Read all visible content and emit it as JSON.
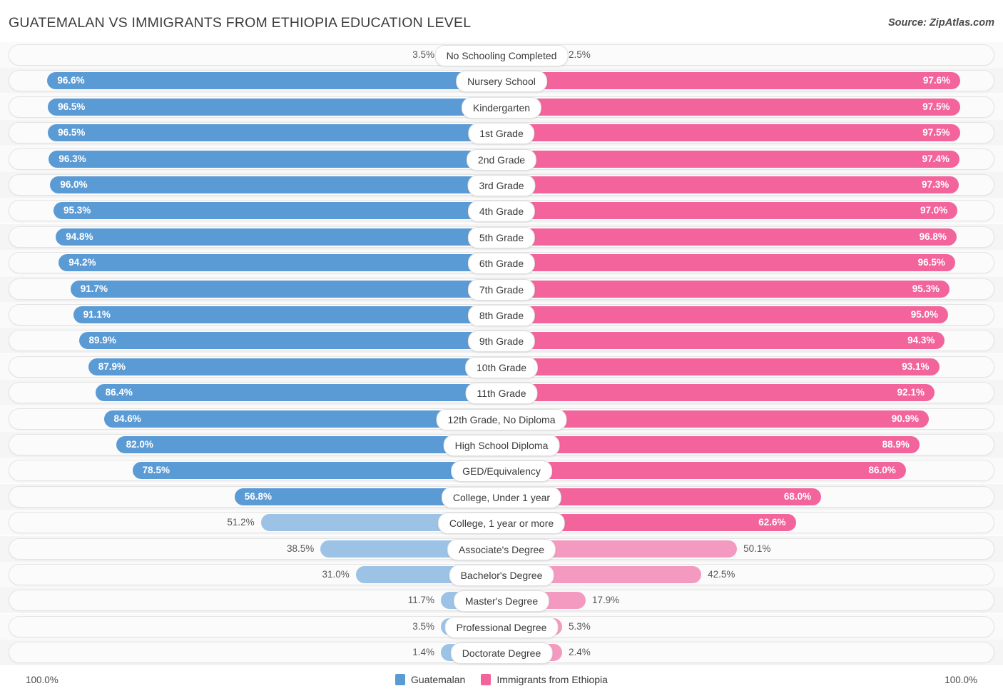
{
  "header": {
    "title": "GUATEMALAN VS IMMIGRANTS FROM ETHIOPIA EDUCATION LEVEL",
    "source": "Source: ZipAtlas.com"
  },
  "footer": {
    "axis_min": "100.0%",
    "axis_max": "100.0%",
    "legend": [
      {
        "label": "Guatemalan",
        "color": "#5B9BD5"
      },
      {
        "label": "Immigrants from Ethiopia",
        "color": "#F2649B"
      }
    ]
  },
  "colors": {
    "left_strong": "#5B9BD5",
    "left_light": "#9CC3E6",
    "right_strong": "#F2649B",
    "right_light": "#F49AC1",
    "track": "#fbfbfb",
    "track_border": "#e4e4e4"
  },
  "chart_data": {
    "type": "bar",
    "orientation": "horizontal-diverging",
    "title": "GUATEMALAN VS IMMIGRANTS FROM ETHIOPIA EDUCATION LEVEL",
    "xlabel": "",
    "ylabel": "",
    "xlim": [
      0,
      100
    ],
    "grid": false,
    "legend_position": "bottom-center",
    "series": [
      {
        "name": "Guatemalan",
        "color": "#5B9BD5",
        "side": "left",
        "values": [
          3.5,
          96.6,
          96.5,
          96.5,
          96.3,
          96.0,
          95.3,
          94.8,
          94.2,
          91.7,
          91.1,
          89.9,
          87.9,
          86.4,
          84.6,
          82.0,
          78.5,
          56.8,
          51.2,
          38.5,
          31.0,
          11.7,
          3.5,
          1.4
        ]
      },
      {
        "name": "Immigrants from Ethiopia",
        "color": "#F2649B",
        "side": "right",
        "values": [
          2.5,
          97.6,
          97.5,
          97.5,
          97.4,
          97.3,
          97.0,
          96.8,
          96.5,
          95.3,
          95.0,
          94.3,
          93.1,
          92.1,
          90.9,
          88.9,
          86.0,
          68.0,
          62.6,
          50.1,
          42.5,
          17.9,
          5.3,
          2.4
        ]
      }
    ],
    "categories": [
      "No Schooling Completed",
      "Nursery School",
      "Kindergarten",
      "1st Grade",
      "2nd Grade",
      "3rd Grade",
      "4th Grade",
      "5th Grade",
      "6th Grade",
      "7th Grade",
      "8th Grade",
      "9th Grade",
      "10th Grade",
      "11th Grade",
      "12th Grade, No Diploma",
      "High School Diploma",
      "GED/Equivalency",
      "College, Under 1 year",
      "College, 1 year or more",
      "Associate's Degree",
      "Bachelor's Degree",
      "Master's Degree",
      "Professional Degree",
      "Doctorate Degree"
    ]
  },
  "rows": [
    {
      "label": "No Schooling Completed",
      "left": "3.5%",
      "right": "2.5%",
      "lv": 3.5,
      "rv": 2.5
    },
    {
      "label": "Nursery School",
      "left": "96.6%",
      "right": "97.6%",
      "lv": 96.6,
      "rv": 97.6
    },
    {
      "label": "Kindergarten",
      "left": "96.5%",
      "right": "97.5%",
      "lv": 96.5,
      "rv": 97.5
    },
    {
      "label": "1st Grade",
      "left": "96.5%",
      "right": "97.5%",
      "lv": 96.5,
      "rv": 97.5
    },
    {
      "label": "2nd Grade",
      "left": "96.3%",
      "right": "97.4%",
      "lv": 96.3,
      "rv": 97.4
    },
    {
      "label": "3rd Grade",
      "left": "96.0%",
      "right": "97.3%",
      "lv": 96.0,
      "rv": 97.3
    },
    {
      "label": "4th Grade",
      "left": "95.3%",
      "right": "97.0%",
      "lv": 95.3,
      "rv": 97.0
    },
    {
      "label": "5th Grade",
      "left": "94.8%",
      "right": "96.8%",
      "lv": 94.8,
      "rv": 96.8
    },
    {
      "label": "6th Grade",
      "left": "94.2%",
      "right": "96.5%",
      "lv": 94.2,
      "rv": 96.5
    },
    {
      "label": "7th Grade",
      "left": "91.7%",
      "right": "95.3%",
      "lv": 91.7,
      "rv": 95.3
    },
    {
      "label": "8th Grade",
      "left": "91.1%",
      "right": "95.0%",
      "lv": 91.1,
      "rv": 95.0
    },
    {
      "label": "9th Grade",
      "left": "89.9%",
      "right": "94.3%",
      "lv": 89.9,
      "rv": 94.3
    },
    {
      "label": "10th Grade",
      "left": "87.9%",
      "right": "93.1%",
      "lv": 87.9,
      "rv": 93.1
    },
    {
      "label": "11th Grade",
      "left": "86.4%",
      "right": "92.1%",
      "lv": 86.4,
      "rv": 92.1
    },
    {
      "label": "12th Grade, No Diploma",
      "left": "84.6%",
      "right": "90.9%",
      "lv": 84.6,
      "rv": 90.9
    },
    {
      "label": "High School Diploma",
      "left": "82.0%",
      "right": "88.9%",
      "lv": 82.0,
      "rv": 88.9
    },
    {
      "label": "GED/Equivalency",
      "left": "78.5%",
      "right": "86.0%",
      "lv": 78.5,
      "rv": 86.0
    },
    {
      "label": "College, Under 1 year",
      "left": "56.8%",
      "right": "68.0%",
      "lv": 56.8,
      "rv": 68.0
    },
    {
      "label": "College, 1 year or more",
      "left": "51.2%",
      "right": "62.6%",
      "lv": 51.2,
      "rv": 62.6
    },
    {
      "label": "Associate's Degree",
      "left": "38.5%",
      "right": "50.1%",
      "lv": 38.5,
      "rv": 50.1
    },
    {
      "label": "Bachelor's Degree",
      "left": "31.0%",
      "right": "42.5%",
      "lv": 31.0,
      "rv": 42.5
    },
    {
      "label": "Master's Degree",
      "left": "11.7%",
      "right": "17.9%",
      "lv": 11.7,
      "rv": 17.9
    },
    {
      "label": "Professional Degree",
      "left": "3.5%",
      "right": "5.3%",
      "lv": 3.5,
      "rv": 5.3
    },
    {
      "label": "Doctorate Degree",
      "left": "1.4%",
      "right": "2.4%",
      "lv": 1.4,
      "rv": 2.4
    }
  ]
}
